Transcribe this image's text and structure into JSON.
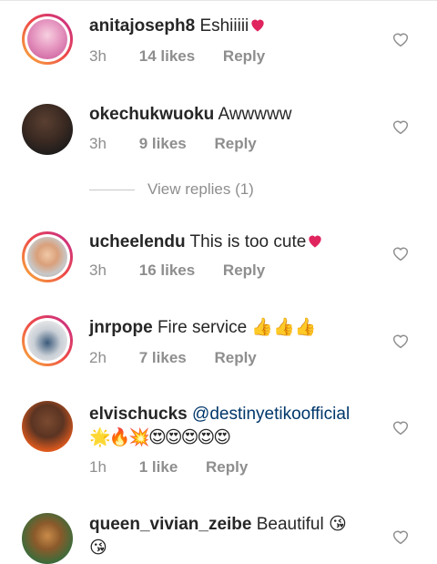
{
  "comments": [
    {
      "username": "anitajoseph8",
      "text": "Eshiiiii",
      "emoji": [
        "red-heart"
      ],
      "time": "3h",
      "likes": "14 likes",
      "reply": "Reply"
    },
    {
      "username": "okechukwuoku",
      "text": "Awwwww",
      "time": "3h",
      "likes": "9 likes",
      "reply": "Reply"
    },
    {
      "username": "ucheelendu",
      "text": "This is too cute",
      "emoji": [
        "red-heart"
      ],
      "time": "3h",
      "likes": "16 likes",
      "reply": "Reply"
    },
    {
      "username": "jnrpope",
      "text": "Fire service",
      "emoji": [
        "thumbs-up",
        "thumbs-up",
        "thumbs-up"
      ],
      "time": "2h",
      "likes": "7 likes",
      "reply": "Reply"
    },
    {
      "username": "elvischucks",
      "mention": "@destinyetikoofficial",
      "emoji": [
        "star",
        "fire",
        "collision",
        "heart-eyes",
        "heart-eyes",
        "heart-eyes",
        "heart-eyes",
        "heart-eyes"
      ],
      "time": "1h",
      "likes": "1 like",
      "reply": "Reply"
    },
    {
      "username": "queen_vivian_zeibe",
      "text": "Beautiful",
      "emoji": [
        "kissing-face",
        "kissing-face"
      ]
    }
  ],
  "view_replies": "View replies (1)",
  "colors": {
    "heart": "#e0245e",
    "meta": "#8e8e8e",
    "mention": "#00376b",
    "username": "#262626"
  }
}
